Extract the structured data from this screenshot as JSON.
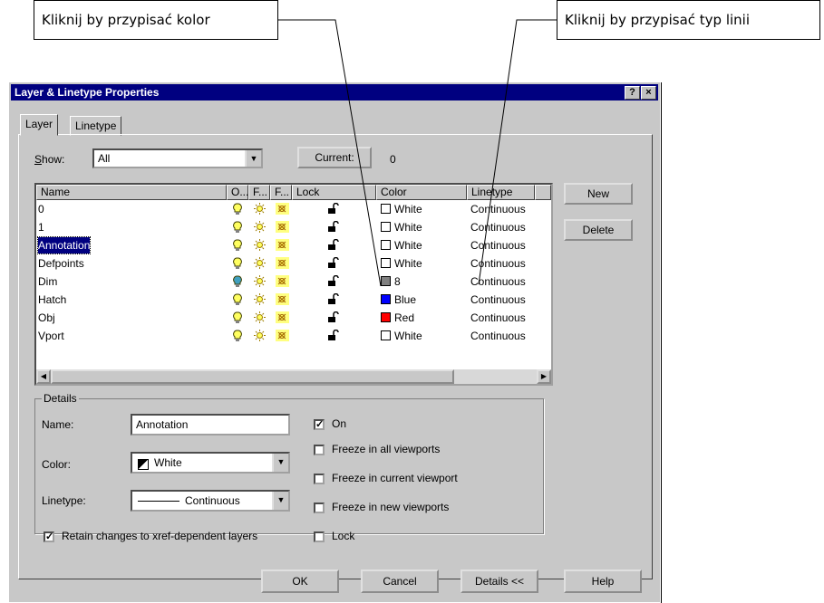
{
  "callouts": {
    "color": "Kliknij by przypisać kolor",
    "linetype": "Kliknij by przypisać typ linii"
  },
  "dialog": {
    "title": "Layer & Linetype Properties",
    "help_button": "?",
    "close_button": "×",
    "tabs": [
      "Layer",
      "Linetype"
    ],
    "show_label": "Show:",
    "show_value": "All",
    "current_button": "Current:",
    "current_value": "0",
    "columns": [
      "Name",
      "O...",
      "F...",
      "F...",
      "Lock",
      "Color",
      "Linetype"
    ],
    "layers": [
      {
        "name": "0",
        "color": "White",
        "swatch": "#ffffff",
        "linetype": "Continuous",
        "on": true
      },
      {
        "name": "1",
        "color": "White",
        "swatch": "#ffffff",
        "linetype": "Continuous",
        "on": true
      },
      {
        "name": "Annotation",
        "color": "White",
        "swatch": "#ffffff",
        "linetype": "Continuous",
        "on": true,
        "selected": true
      },
      {
        "name": "Defpoints",
        "color": "White",
        "swatch": "#ffffff",
        "linetype": "Continuous",
        "on": true
      },
      {
        "name": "Dim",
        "color": "8",
        "swatch": "#808080",
        "linetype": "Continuous",
        "on": false
      },
      {
        "name": "Hatch",
        "color": "Blue",
        "swatch": "#0000ff",
        "linetype": "Continuous",
        "on": true
      },
      {
        "name": "Obj",
        "color": "Red",
        "swatch": "#ff0000",
        "linetype": "Continuous",
        "on": true
      },
      {
        "name": "Vport",
        "color": "White",
        "swatch": "#ffffff",
        "linetype": "Continuous",
        "on": true
      }
    ],
    "new_button": "New",
    "delete_button": "Delete",
    "details": {
      "group_label": "Details",
      "name_label": "Name:",
      "name_value": "Annotation",
      "color_label": "Color:",
      "color_value": "White",
      "linetype_label": "Linetype:",
      "linetype_value": "Continuous",
      "retain_label": "Retain changes to xref-dependent layers",
      "retain_checked": true,
      "on_label": "On",
      "on_checked": true,
      "freeze_all_label": "Freeze in all viewports",
      "freeze_current_label": "Freeze in current viewport",
      "freeze_new_label": "Freeze in new viewports",
      "lock_label": "Lock"
    },
    "ok_button": "OK",
    "cancel_button": "Cancel",
    "details_button": "Details <<",
    "help_bottom_button": "Help"
  }
}
